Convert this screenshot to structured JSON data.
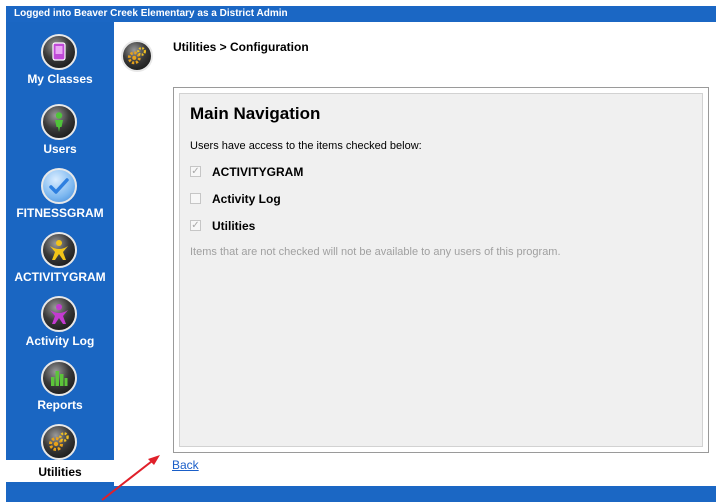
{
  "header": {
    "login_status": "Logged into Beaver Creek Elementary as a District Admin"
  },
  "sidebar": {
    "items": [
      {
        "label": "My Classes",
        "icon": "my-classes-icon",
        "selected": false
      },
      {
        "label": "Users",
        "icon": "users-icon",
        "selected": false
      },
      {
        "label": "FITNESSGRAM",
        "icon": "fitnessgram-icon",
        "selected": false
      },
      {
        "label": "ACTIVITYGRAM",
        "icon": "activitygram-icon",
        "selected": false
      },
      {
        "label": "Activity Log",
        "icon": "activity-log-icon",
        "selected": false
      },
      {
        "label": "Reports",
        "icon": "reports-icon",
        "selected": false
      },
      {
        "label": "Utilities",
        "icon": "utilities-icon",
        "selected": true
      }
    ]
  },
  "main": {
    "breadcrumb": "Utilities > Configuration",
    "panel": {
      "title": "Main Navigation",
      "description": "Users have access to the items checked below:",
      "options": [
        {
          "label": "ACTIVITYGRAM",
          "checked": true
        },
        {
          "label": "Activity Log",
          "checked": false
        },
        {
          "label": "Utilities",
          "checked": true
        }
      ],
      "note": "Items that are not checked will not be available to any users of this program."
    },
    "back_link": "Back"
  },
  "colors": {
    "nav_blue": "#1a66c2",
    "link_blue": "#1a5ec8",
    "annotation_arrow": "#e0202a"
  }
}
